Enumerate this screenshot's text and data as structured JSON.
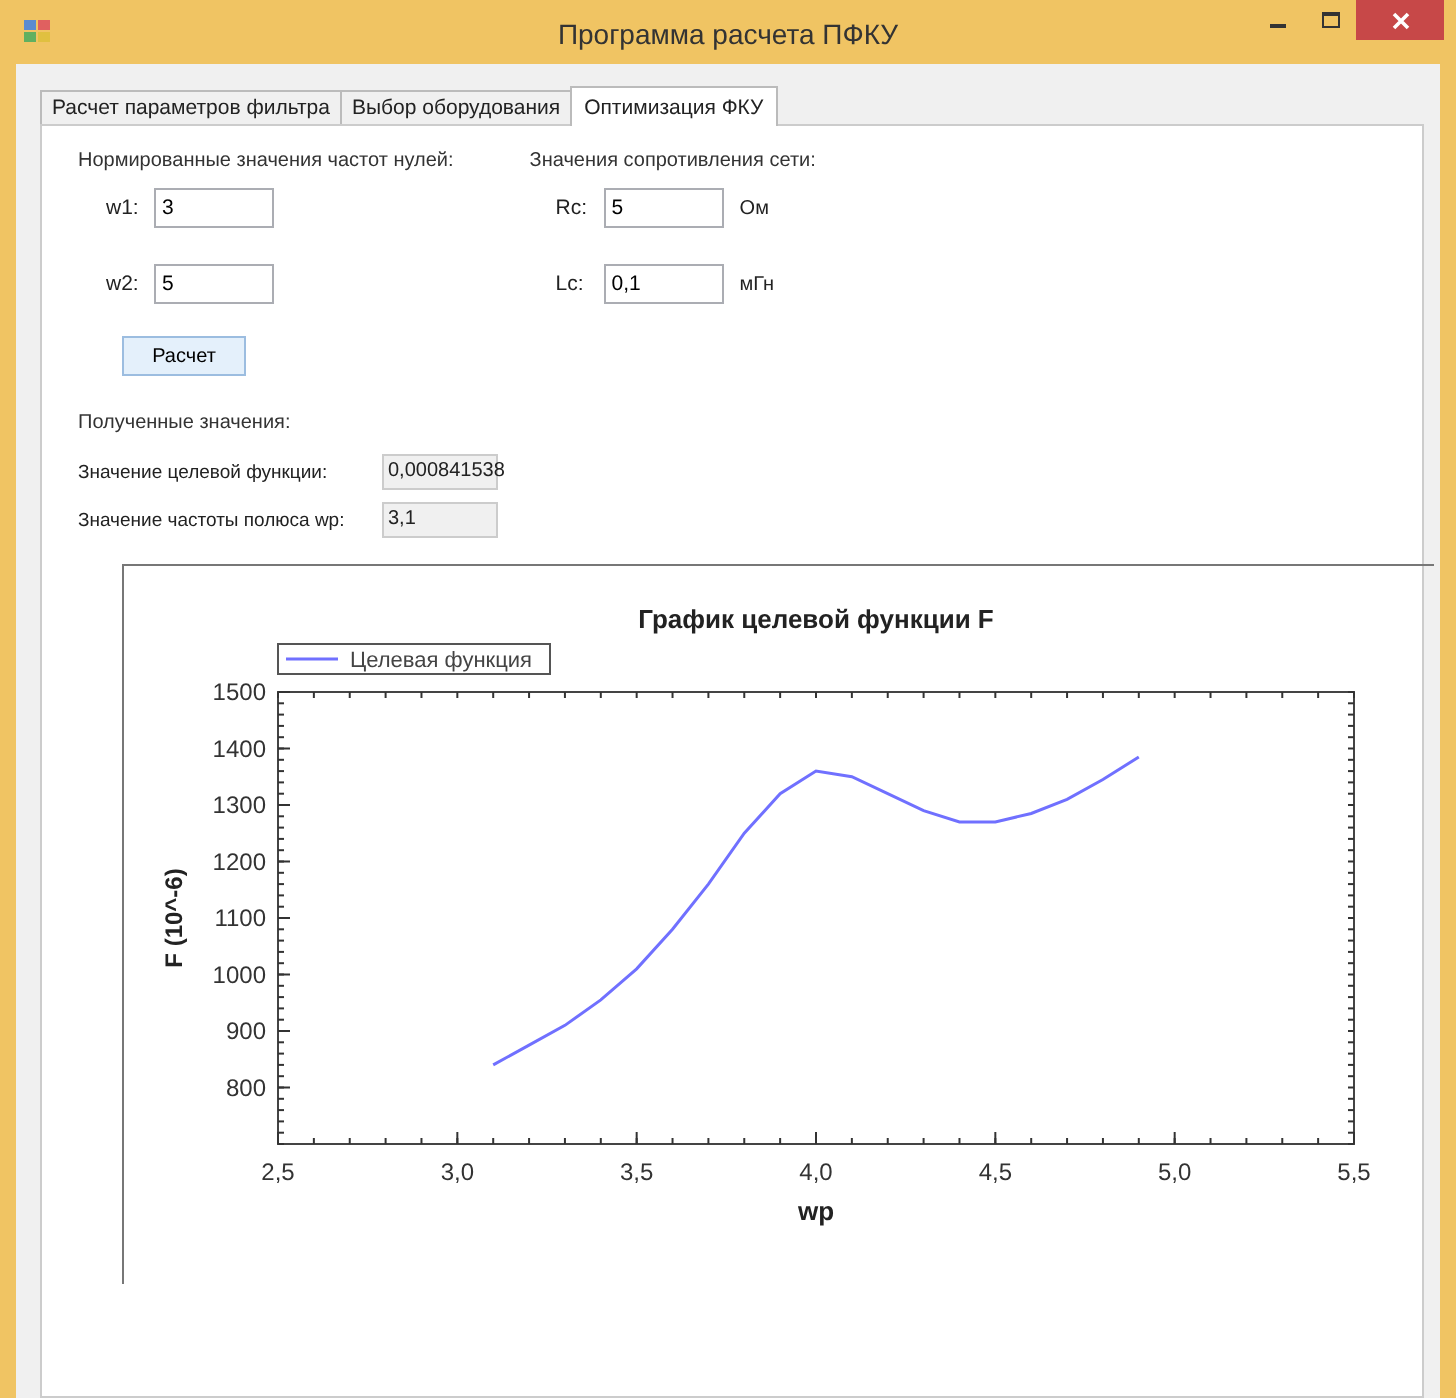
{
  "window": {
    "title": "Программа расчета ПФКУ"
  },
  "tabs": [
    {
      "label": "Расчет параметров фильтра",
      "selected": false
    },
    {
      "label": "Выбор оборудования",
      "selected": false
    },
    {
      "label": "Оптимизация ФКУ",
      "selected": true
    }
  ],
  "zeros_group": {
    "label": "Нормированные значения частот нулей:",
    "fields": [
      {
        "label": "w1:",
        "value": "3"
      },
      {
        "label": "w2:",
        "value": "5"
      }
    ]
  },
  "network_group": {
    "label": "Значения сопротивления сети:",
    "fields": [
      {
        "label": "Rc:",
        "value": "5",
        "unit": "Ом"
      },
      {
        "label": "Lc:",
        "value": "0,1",
        "unit": "мГн"
      }
    ]
  },
  "calculate_button": "Расчет",
  "results": {
    "label": "Полученные значения:",
    "fields": [
      {
        "label": "Значение целевой функции:",
        "value": "0,000841538"
      },
      {
        "label": "Значение частоты полюса wp:",
        "value": "3,1"
      }
    ]
  },
  "chart": {
    "chart_data": {
      "type": "line",
      "title": "График целевой функции F",
      "xlabel": "wp",
      "ylabel": "F (10^-6)",
      "x": [
        3.1,
        3.2,
        3.3,
        3.4,
        3.5,
        3.6,
        3.7,
        3.8,
        3.9,
        4.0,
        4.1,
        4.2,
        4.3,
        4.4,
        4.5,
        4.6,
        4.7,
        4.8,
        4.9
      ],
      "series": [
        {
          "name": "Целевая функция",
          "color": "#7070ff",
          "values": [
            840,
            875,
            910,
            955,
            1010,
            1080,
            1160,
            1250,
            1320,
            1360,
            1350,
            1320,
            1290,
            1270,
            1270,
            1285,
            1310,
            1345,
            1385
          ]
        }
      ],
      "xlim": [
        2.5,
        5.5
      ],
      "ylim": [
        700,
        1500
      ],
      "xticks": [
        {
          "value": 2.5,
          "label": "2,5"
        },
        {
          "value": 3.0,
          "label": "3,0"
        },
        {
          "value": 3.5,
          "label": "3,5"
        },
        {
          "value": 4.0,
          "label": "4,0"
        },
        {
          "value": 4.5,
          "label": "4,5"
        },
        {
          "value": 5.0,
          "label": "5,0"
        },
        {
          "value": 5.5,
          "label": "5,5"
        }
      ],
      "yticks": [
        800,
        900,
        1000,
        1100,
        1200,
        1300,
        1400,
        1500
      ]
    }
  }
}
